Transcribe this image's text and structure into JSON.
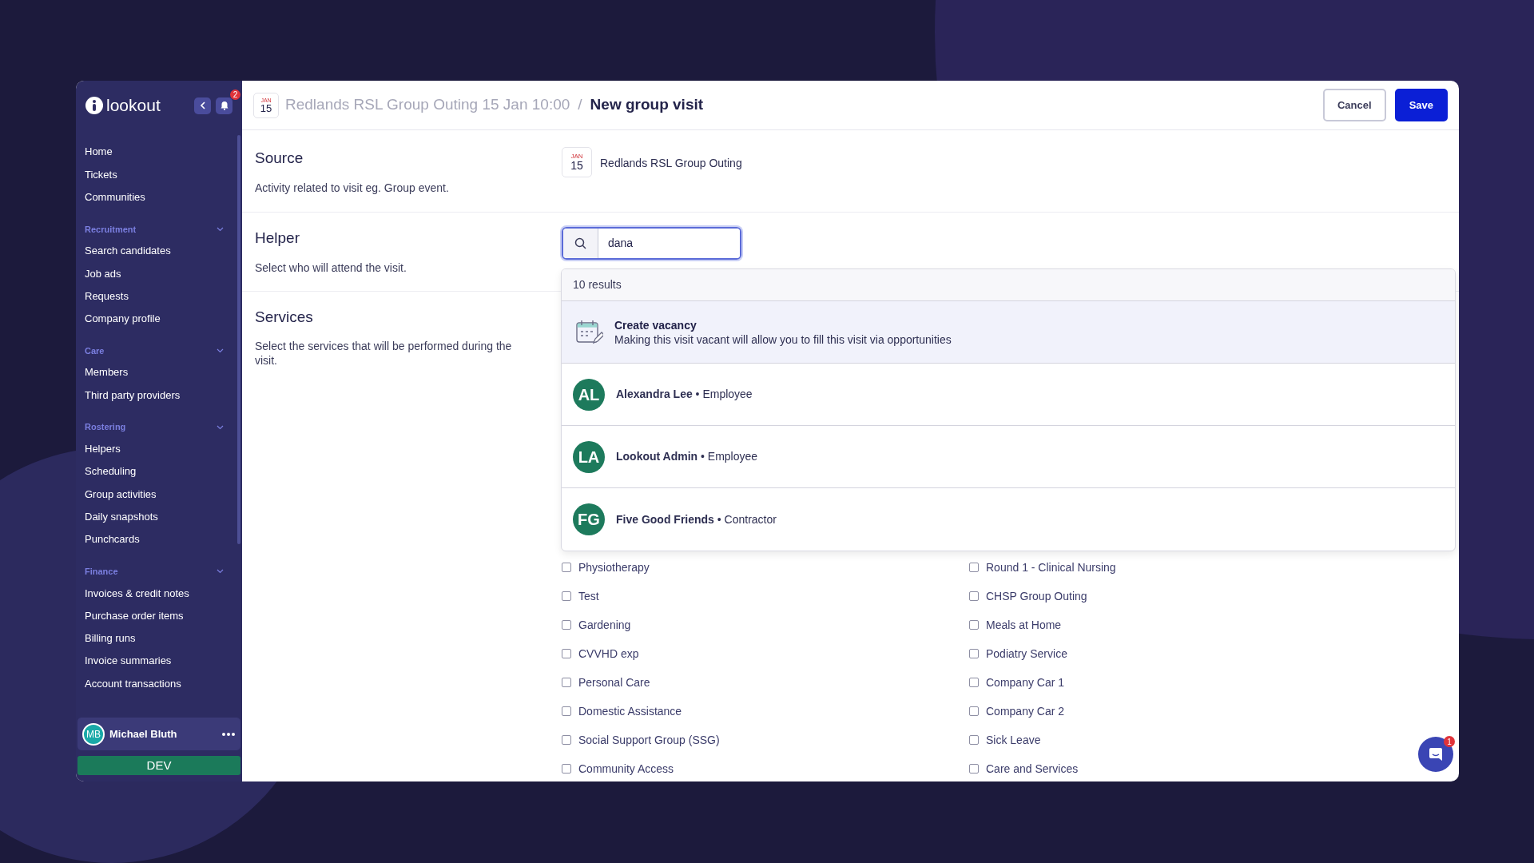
{
  "sidebar": {
    "brand": "lookout",
    "notification_count": "2",
    "groups": [
      {
        "items": [
          "Home",
          "Tickets",
          "Communities"
        ]
      },
      {
        "title": "Recruitment",
        "expanded": true,
        "items": [
          "Search candidates",
          "Job ads",
          "Requests",
          "Company profile"
        ]
      },
      {
        "title": "Care",
        "expanded": true,
        "items": [
          "Members",
          "Third party providers"
        ]
      },
      {
        "title": "Rostering",
        "expanded": true,
        "items": [
          "Helpers",
          "Scheduling",
          "Group activities",
          "Daily snapshots",
          "Punchcards"
        ]
      },
      {
        "title": "Finance",
        "expanded": true,
        "items": [
          "Invoices & credit notes",
          "Purchase order items",
          "Billing runs",
          "Invoice summaries",
          "Account transactions"
        ]
      }
    ],
    "user": {
      "initials": "MB",
      "name": "Michael Bluth"
    },
    "environment": "DEV"
  },
  "header": {
    "date": {
      "month": "JAN",
      "day": "15"
    },
    "breadcrumb": "Redlands RSL Group Outing 15 Jan 10:00",
    "separator": "/",
    "title": "New group visit",
    "buttons": [
      {
        "label": "Cancel",
        "kind": "secondary"
      },
      {
        "label": "Save",
        "kind": "primary"
      }
    ]
  },
  "source": {
    "title": "Source",
    "description": "Activity related to visit eg. Group event.",
    "date": {
      "month": "JAN",
      "day": "15"
    },
    "activity": "Redlands RSL Group Outing"
  },
  "helper": {
    "title": "Helper",
    "description": "Select who will attend the visit.",
    "search_value": "dana",
    "results_count": "10 results",
    "vacancy": {
      "title": "Create vacancy",
      "description": "Making this visit vacant will allow you to fill this visit via opportunities"
    },
    "results": [
      {
        "initials": "AL",
        "label": "**Alexandra Lee** • Employee"
      },
      {
        "initials": "LA",
        "label": "**Lookout Admin** • Employee"
      },
      {
        "initials": "FG",
        "label": "**Five Good Friends** • Contractor"
      }
    ]
  },
  "services": {
    "title": "Services",
    "description": "Select the services that will be performed during the visit.",
    "options": [
      {
        "label": "Physiotherapy",
        "checked": false
      },
      {
        "label": "Round 1 - Clinical Nursing",
        "checked": false
      },
      {
        "label": "Test",
        "checked": false
      },
      {
        "label": "CHSP Group Outing",
        "checked": false
      },
      {
        "label": "Gardening",
        "checked": false
      },
      {
        "label": "Meals at Home",
        "checked": false
      },
      {
        "label": "CVVHD exp",
        "checked": false
      },
      {
        "label": "Podiatry Service",
        "checked": false
      },
      {
        "label": "Personal Care",
        "checked": false
      },
      {
        "label": "Company Car 1",
        "checked": false
      },
      {
        "label": "Domestic Assistance",
        "checked": false
      },
      {
        "label": "Company Car 2",
        "checked": false
      },
      {
        "label": "Social Support Group (SSG)",
        "checked": false
      },
      {
        "label": "Sick Leave",
        "checked": false
      },
      {
        "label": "Community Access",
        "checked": false
      },
      {
        "label": "Care and Services",
        "checked": false
      }
    ]
  },
  "chat": {
    "badge": "1"
  }
}
